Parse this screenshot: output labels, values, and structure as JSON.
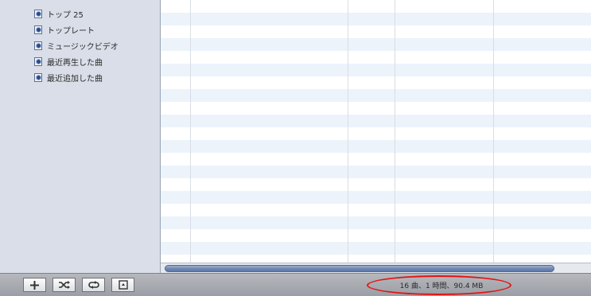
{
  "sidebar": {
    "items": [
      {
        "label": "トップ 25",
        "icon": "smart-playlist-icon"
      },
      {
        "label": "トップレート",
        "icon": "smart-playlist-icon"
      },
      {
        "label": "ミュージックビデオ",
        "icon": "smart-playlist-icon"
      },
      {
        "label": "最近再生した曲",
        "icon": "smart-playlist-icon"
      },
      {
        "label": "最近追加した曲",
        "icon": "smart-playlist-icon"
      }
    ]
  },
  "toolbar": {
    "buttons": [
      {
        "name": "add-playlist-button",
        "icon": "plus-icon"
      },
      {
        "name": "shuffle-button",
        "icon": "shuffle-icon"
      },
      {
        "name": "repeat-button",
        "icon": "repeat-icon"
      },
      {
        "name": "artwork-button",
        "icon": "artwork-icon"
      }
    ]
  },
  "status": {
    "text": "16 曲、1 時間、90.4 MB"
  },
  "colors": {
    "sidebar_bg": "#d9dee8",
    "row_alt": "#edf3fb",
    "highlight": "#e01515"
  }
}
